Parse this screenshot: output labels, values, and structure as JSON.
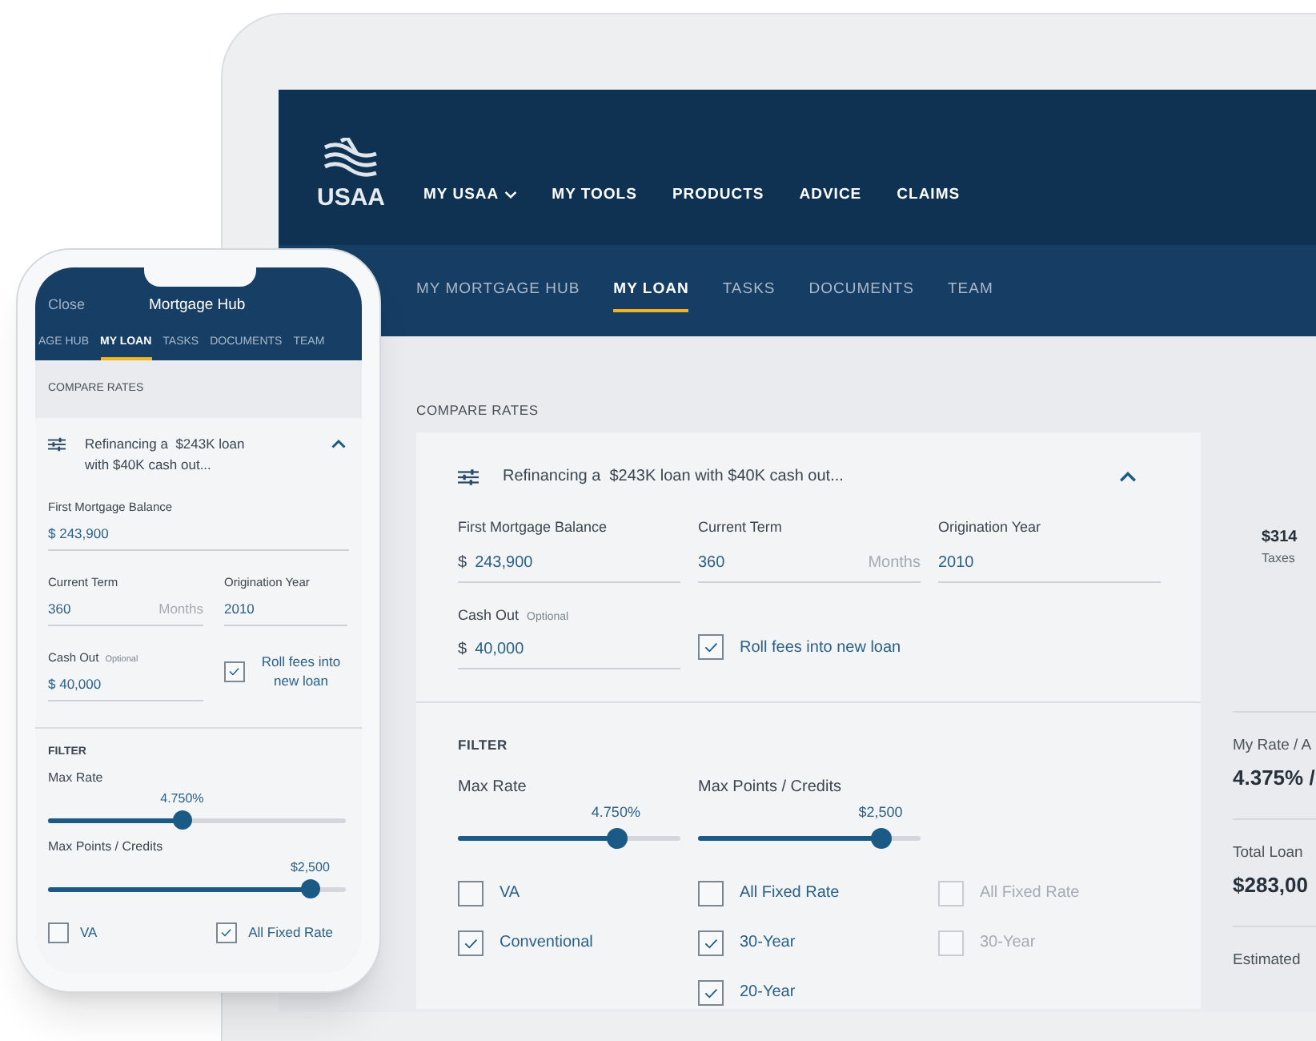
{
  "tablet": {
    "logo": "USAA",
    "main_nav": [
      {
        "label": "MY USAA",
        "kind": "dropdown"
      },
      {
        "label": "MY TOOLS",
        "kind": "link"
      },
      {
        "label": "PRODUCTS",
        "kind": "link"
      },
      {
        "label": "ADVICE",
        "kind": "link"
      },
      {
        "label": "CLAIMS",
        "kind": "link"
      }
    ],
    "tabs": [
      {
        "label": "MY MORTGAGE HUB",
        "selected": false
      },
      {
        "label": "MY LOAN",
        "selected": true
      },
      {
        "label": "TASKS",
        "selected": false
      },
      {
        "label": "DOCUMENTS",
        "selected": false
      },
      {
        "label": "TEAM",
        "selected": false
      }
    ],
    "section_title": "COMPARE RATES",
    "summary": "Refinancing a  $243K loan with $40K cash out...",
    "expanded": true,
    "fields": [
      {
        "label": "First Mortgage Balance",
        "prefix": "$",
        "value": "243,900"
      },
      {
        "label": "Current Term",
        "value": "360",
        "suffix": "Months"
      },
      {
        "label": "Origination Year",
        "value": "2010"
      },
      {
        "label": "Cash Out",
        "note": "Optional",
        "prefix": "$",
        "value": "40,000"
      }
    ],
    "roll_fees": {
      "label": "Roll fees into new loan",
      "checked": true
    },
    "filter_title": "FILTER",
    "sliders": [
      {
        "label": "Max Rate",
        "reading": "4.750%",
        "level": 0.71
      },
      {
        "label": "Max Points / Credits",
        "reading": "$2,500",
        "level": 0.82
      }
    ],
    "checkbox_columns": [
      [
        {
          "label": "VA",
          "checked": false,
          "disabled": false
        },
        {
          "label": "Conventional",
          "checked": true,
          "disabled": false
        }
      ],
      [
        {
          "label": "All Fixed Rate",
          "checked": false,
          "disabled": false
        },
        {
          "label": "30-Year",
          "checked": true,
          "disabled": false
        },
        {
          "label": "20-Year",
          "checked": true,
          "disabled": false
        }
      ],
      [
        {
          "label": "All Fixed Rate",
          "checked": false,
          "disabled": true
        },
        {
          "label": "30-Year",
          "checked": false,
          "disabled": true
        }
      ]
    ],
    "side_panel": [
      {
        "kind": "value-first",
        "value": "$314",
        "label": "Taxes"
      },
      {
        "kind": "label-first",
        "label": "My Rate / A",
        "value": "4.375% /"
      },
      {
        "kind": "label-first",
        "label": "Total Loan",
        "value": "$283,00"
      },
      {
        "kind": "label-first",
        "label": "Estimated"
      }
    ]
  },
  "phone": {
    "close": "Close",
    "title": "Mortgage Hub",
    "tabs": [
      {
        "label": "AGE HUB",
        "selected": false
      },
      {
        "label": "MY LOAN",
        "selected": true
      },
      {
        "label": "TASKS",
        "selected": false
      },
      {
        "label": "DOCUMENTS",
        "selected": false
      },
      {
        "label": "TEAM",
        "selected": false
      }
    ],
    "section_title": "COMPARE RATES",
    "summary": "Refinancing a  $243K loan with $40K cash out...",
    "expanded": true,
    "fields": [
      {
        "label": "First Mortgage Balance",
        "value": "$ 243,900"
      },
      {
        "label": "Current Term",
        "value": "360",
        "suffix": "Months"
      },
      {
        "label": "Origination Year",
        "value": "2010"
      },
      {
        "label": "Cash Out",
        "note": "Optional",
        "value": "$ 40,000"
      }
    ],
    "roll_fees": {
      "label": "Roll fees into new loan",
      "checked": true
    },
    "filter_title": "FILTER",
    "sliders": [
      {
        "label": "Max Rate",
        "reading": "4.750%",
        "level": 0.45
      },
      {
        "label": "Max Points / Credits",
        "reading": "$2,500",
        "level": 0.88
      }
    ],
    "checkboxes": [
      {
        "label": "VA",
        "checked": false,
        "disabled": false
      },
      {
        "label": "All Fixed Rate",
        "checked": true,
        "disabled": false
      }
    ]
  }
}
